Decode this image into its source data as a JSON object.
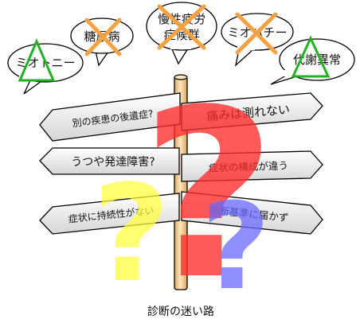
{
  "bubbles": [
    {
      "lines": [
        "ミオトニー"
      ],
      "mark": "triangle"
    },
    {
      "lines": [
        "糖尿病"
      ],
      "mark": "cross"
    },
    {
      "lines": [
        "慢性疲労",
        "症候群"
      ],
      "mark": "cross"
    },
    {
      "lines": [
        "ミオパチー"
      ],
      "mark": "cross"
    },
    {
      "lines": [
        "代謝異常"
      ],
      "mark": "triangle"
    }
  ],
  "signs": [
    {
      "label": "別の疾患の後遺症?",
      "direction": "left"
    },
    {
      "label": "痛みは測れない",
      "direction": "right"
    },
    {
      "label": "うつや発達障害?",
      "direction": "left"
    },
    {
      "label": "症状の構成が違う",
      "direction": "right"
    },
    {
      "label": "症状に持続性がない",
      "direction": "left"
    },
    {
      "label": "診断基準に届かず",
      "direction": "right"
    }
  ],
  "question_marks": [
    {
      "color": "#ff2b2b",
      "symbol": "?"
    },
    {
      "color": "#ffff38",
      "symbol": "?"
    },
    {
      "color": "#6a6aff",
      "symbol": "?"
    }
  ],
  "caption": "診断の迷い路",
  "colors": {
    "triangle_mark": "#22b022",
    "cross_mark": "#f5a243",
    "sign_fill_top": "#ffffff",
    "sign_fill_bottom": "#d9d9d9",
    "pole": "#f0c98a",
    "outline": "#000000"
  }
}
